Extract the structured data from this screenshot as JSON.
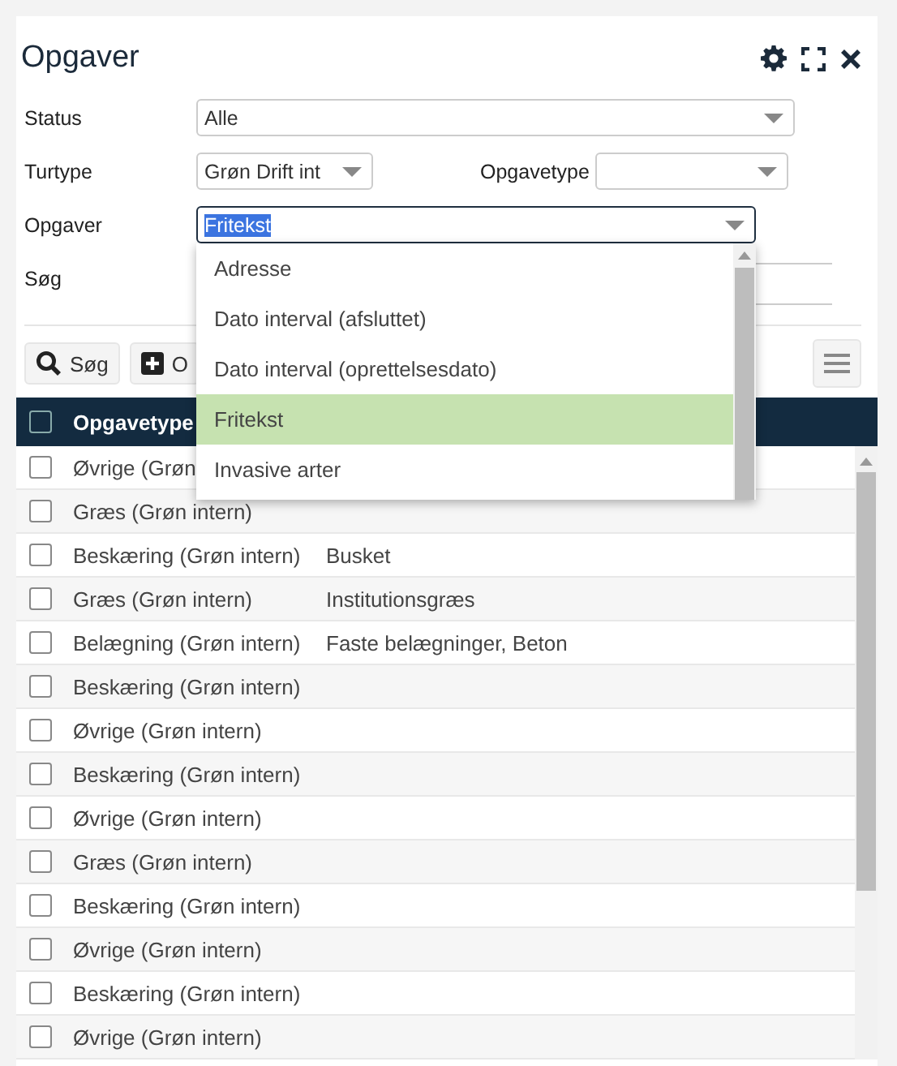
{
  "window": {
    "title": "Opgaver"
  },
  "filters": {
    "status": {
      "label": "Status",
      "value": "Alle"
    },
    "turtype": {
      "label": "Turtype",
      "value": "Grøn Drift int"
    },
    "opgavetype": {
      "label": "Opgavetype"
    },
    "opgaver": {
      "label": "Opgaver",
      "value": "Fritekst",
      "expanded": true
    },
    "search": {
      "label": "Søg"
    }
  },
  "dropdown_options": [
    {
      "label": "Adresse",
      "selected": false
    },
    {
      "label": "Dato interval (afsluttet)",
      "selected": false
    },
    {
      "label": "Dato interval (oprettelsesdato)",
      "selected": false
    },
    {
      "label": "Fritekst",
      "selected": true
    },
    {
      "label": "Invasive arter",
      "selected": false
    }
  ],
  "toolbar": [
    {
      "kind": "search",
      "label": "Søg"
    },
    {
      "kind": "add",
      "label": "O"
    }
  ],
  "table": {
    "header_checked": false,
    "columns": [
      "Opgavetype"
    ],
    "rows": [
      {
        "type": "Øvrige (Grøn",
        "detail": "",
        "checked": false
      },
      {
        "type": "Græs (Grøn intern)",
        "detail": "",
        "checked": false
      },
      {
        "type": "Beskæring (Grøn intern)",
        "detail": "Busket",
        "checked": false
      },
      {
        "type": "Græs (Grøn intern)",
        "detail": "Institutionsgræs",
        "checked": false
      },
      {
        "type": "Belægning (Grøn intern)",
        "detail": "Faste belægninger, Beton",
        "checked": false
      },
      {
        "type": "Beskæring (Grøn intern)",
        "detail": "",
        "checked": false
      },
      {
        "type": "Øvrige (Grøn intern)",
        "detail": "",
        "checked": false
      },
      {
        "type": "Beskæring (Grøn intern)",
        "detail": "",
        "checked": false
      },
      {
        "type": "Øvrige (Grøn intern)",
        "detail": "",
        "checked": false
      },
      {
        "type": "Græs (Grøn intern)",
        "detail": "",
        "checked": false
      },
      {
        "type": "Beskæring (Grøn intern)",
        "detail": "",
        "checked": false
      },
      {
        "type": "Øvrige (Grøn intern)",
        "detail": "",
        "checked": false
      },
      {
        "type": "Beskæring (Grøn intern)",
        "detail": "",
        "checked": false
      },
      {
        "type": "Øvrige (Grøn intern)",
        "detail": "",
        "checked": false
      }
    ]
  }
}
